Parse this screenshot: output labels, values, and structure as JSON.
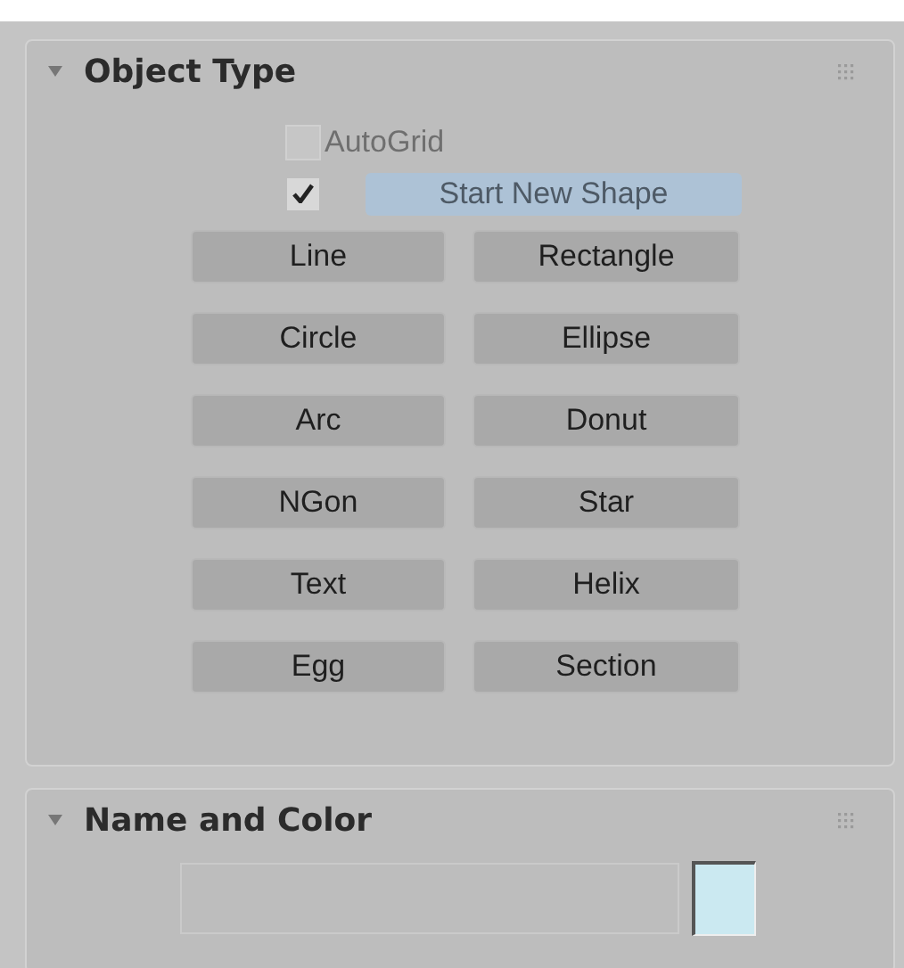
{
  "object_type": {
    "title": "Object Type",
    "expanded": true,
    "autogrid": {
      "label": "AutoGrid",
      "checked": false,
      "disabled": true
    },
    "start_new_shape": {
      "label": "Start New Shape",
      "checked": true,
      "selected": true
    },
    "buttons": [
      {
        "label": "Line",
        "selected": false
      },
      {
        "label": "Rectangle",
        "selected": false
      },
      {
        "label": "Circle",
        "selected": false
      },
      {
        "label": "Ellipse",
        "selected": false
      },
      {
        "label": "Arc",
        "selected": false
      },
      {
        "label": "Donut",
        "selected": false
      },
      {
        "label": "NGon",
        "selected": false
      },
      {
        "label": "Star",
        "selected": false
      },
      {
        "label": "Text",
        "selected": false
      },
      {
        "label": "Helix",
        "selected": false
      },
      {
        "label": "Egg",
        "selected": false
      },
      {
        "label": "Section",
        "selected": false
      }
    ]
  },
  "name_and_color": {
    "title": "Name and Color",
    "expanded": true,
    "color": "#cbe9f1"
  }
}
